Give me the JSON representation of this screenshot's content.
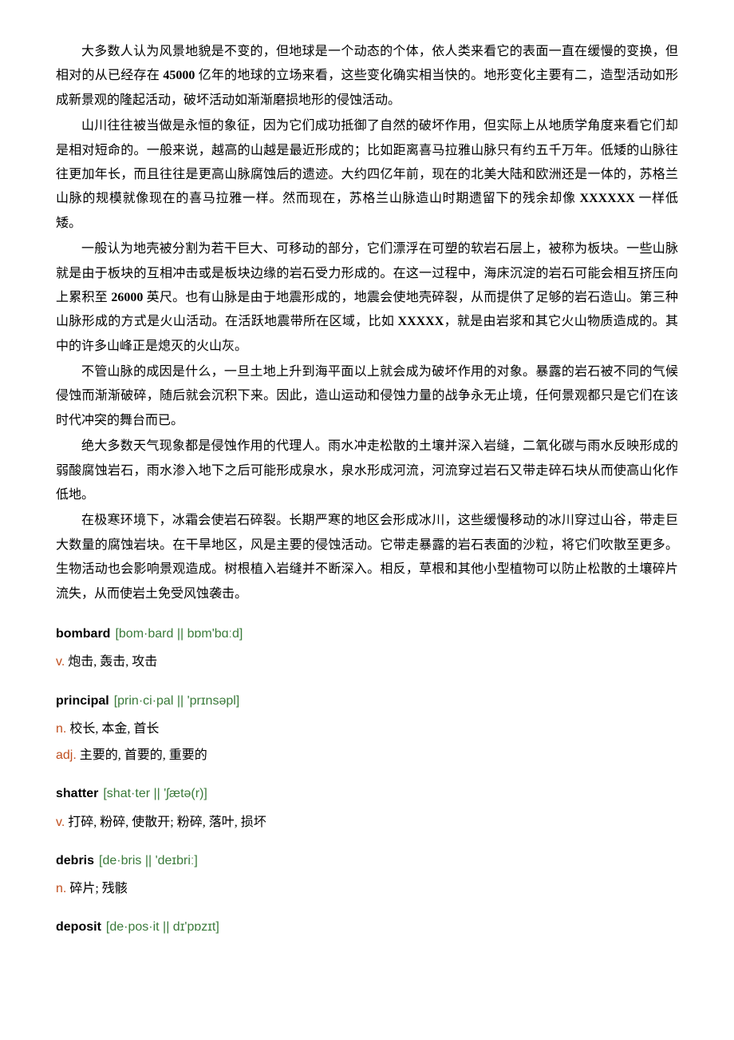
{
  "paragraphs": [
    "大多数人认为风景地貌是不变的，但地球是一个动态的个体，依人类来看它的表面一直在缓慢的变换，但相对的从已经存在 <b>45000</b> 亿年的地球的立场来看，这些变化确实相当快的。地形变化主要有二，造型活动如形成新景观的隆起活动，破坏活动如渐渐磨损地形的侵蚀活动。",
    "山川往往被当做是永恒的象征，因为它们成功抵御了自然的破坏作用，但实际上从地质学角度来看它们却是相对短命的。一般来说，越高的山越是最近形成的；比如距离喜马拉雅山脉只有约五千万年。低矮的山脉往往更加年长，而且往往是更高山脉腐蚀后的遗迹。大约四亿年前，现在的北美大陆和欧洲还是一体的，苏格兰山脉的规模就像现在的喜马拉雅一样。然而现在，苏格兰山脉造山时期遗留下的残余却像 <b>XXXXXX</b> 一样低矮。",
    "一般认为地壳被分割为若干巨大、可移动的部分，它们漂浮在可塑的软岩石层上，被称为板块。一些山脉就是由于板块的互相冲击或是板块边缘的岩石受力形成的。在这一过程中，海床沉淀的岩石可能会相互挤压向上累积至 <b>26000</b> 英尺。也有山脉是由于地震形成的，地震会使地壳碎裂，从而提供了足够的岩石造山。第三种山脉形成的方式是火山活动。在活跃地震带所在区域，比如 <b>XXXXX</b>，就是由岩浆和其它火山物质造成的。其中的许多山峰正是熄灭的火山灰。",
    "不管山脉的成因是什么，一旦土地上升到海平面以上就会成为破坏作用的对象。暴露的岩石被不同的气候侵蚀而渐渐破碎，随后就会沉积下来。因此，造山运动和侵蚀力量的战争永无止境，任何景观都只是它们在该时代冲突的舞台而已。",
    "绝大多数天气现象都是侵蚀作用的代理人。雨水冲走松散的土壤并深入岩缝，二氧化碳与雨水反映形成的弱酸腐蚀岩石，雨水渗入地下之后可能形成泉水，泉水形成河流，河流穿过岩石又带走碎石块从而使高山化作低地。",
    "在极寒环境下，冰霜会使岩石碎裂。长期严寒的地区会形成冰川，这些缓慢移动的冰川穿过山谷，带走巨大数量的腐蚀岩块。在干旱地区，风是主要的侵蚀活动。它带走暴露的岩石表面的沙粒，将它们吹散至更多。生物活动也会影响景观造成。树根植入岩缝并不断深入。相反，草根和其他小型植物可以防止松散的土壤碎片流失，从而使岩土免受风蚀袭击。"
  ],
  "vocab": [
    {
      "word": "bombard",
      "pron": "[bom·bard || bɒm'bɑːd]",
      "defs": [
        {
          "pos": "v.",
          "text": "炮击, 轰击, 攻击"
        }
      ]
    },
    {
      "word": "principal",
      "pron": "[prin·ci·pal || 'prɪnsəpl]",
      "defs": [
        {
          "pos": "n.",
          "text": "校长, 本金, 首长"
        },
        {
          "pos": "adj.",
          "text": "主要的, 首要的, 重要的"
        }
      ]
    },
    {
      "word": "shatter",
      "pron": "[shat·ter || 'ʃætə(r)]",
      "defs": [
        {
          "pos": "v.",
          "text": "打碎, 粉碎, 使散开; 粉碎, 落叶, 损坏"
        }
      ]
    },
    {
      "word": "debris",
      "pron": "[de·bris || 'deɪbriː]",
      "defs": [
        {
          "pos": "n.",
          "text": "碎片; 残骸"
        }
      ]
    },
    {
      "word": "deposit",
      "pron": "[de·pos·it || dɪ'pɒzɪt]",
      "defs": []
    }
  ]
}
